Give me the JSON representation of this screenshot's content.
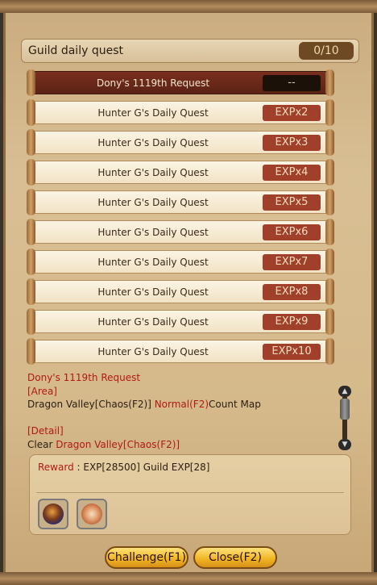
{
  "header": {
    "title": "Guild daily quest",
    "count": "0/10"
  },
  "quests": [
    {
      "name": "Dony's 1119th Request",
      "tag": "--",
      "selected": true
    },
    {
      "name": "Hunter G's Daily Quest",
      "tag": "EXPx2"
    },
    {
      "name": "Hunter G's Daily Quest",
      "tag": "EXPx3"
    },
    {
      "name": "Hunter G's Daily Quest",
      "tag": "EXPx4"
    },
    {
      "name": "Hunter G's Daily Quest",
      "tag": "EXPx5"
    },
    {
      "name": "Hunter G's Daily Quest",
      "tag": "EXPx6"
    },
    {
      "name": "Hunter G's Daily Quest",
      "tag": "EXPx7"
    },
    {
      "name": "Hunter G's Daily Quest",
      "tag": "EXPx8"
    },
    {
      "name": "Hunter G's Daily Quest",
      "tag": "EXPx9"
    },
    {
      "name": "Hunter G's Daily Quest",
      "tag": "EXPx10"
    }
  ],
  "detail": {
    "title": "Dony's 1119th Request",
    "area_label": "[Area]",
    "area_part1": "Dragon Valley[Chaos(F2)]",
    "area_part2": " Normal(F2)",
    "area_part3": "Count Map",
    "detail_label": "[Detail]",
    "detail_part1": "Clear ",
    "detail_part2": "Dragon Valley[Chaos(F2)]"
  },
  "reward": {
    "label": "Reward",
    "sep": " : ",
    "text": "EXP[28500] Guild EXP[28]"
  },
  "buttons": {
    "challenge": "Challenge(F1)",
    "close": "Close(F2)"
  },
  "colors": {
    "accent_red": "#b11a12",
    "tag_bg": "#a1402a",
    "button_gold": "#f0b320"
  }
}
